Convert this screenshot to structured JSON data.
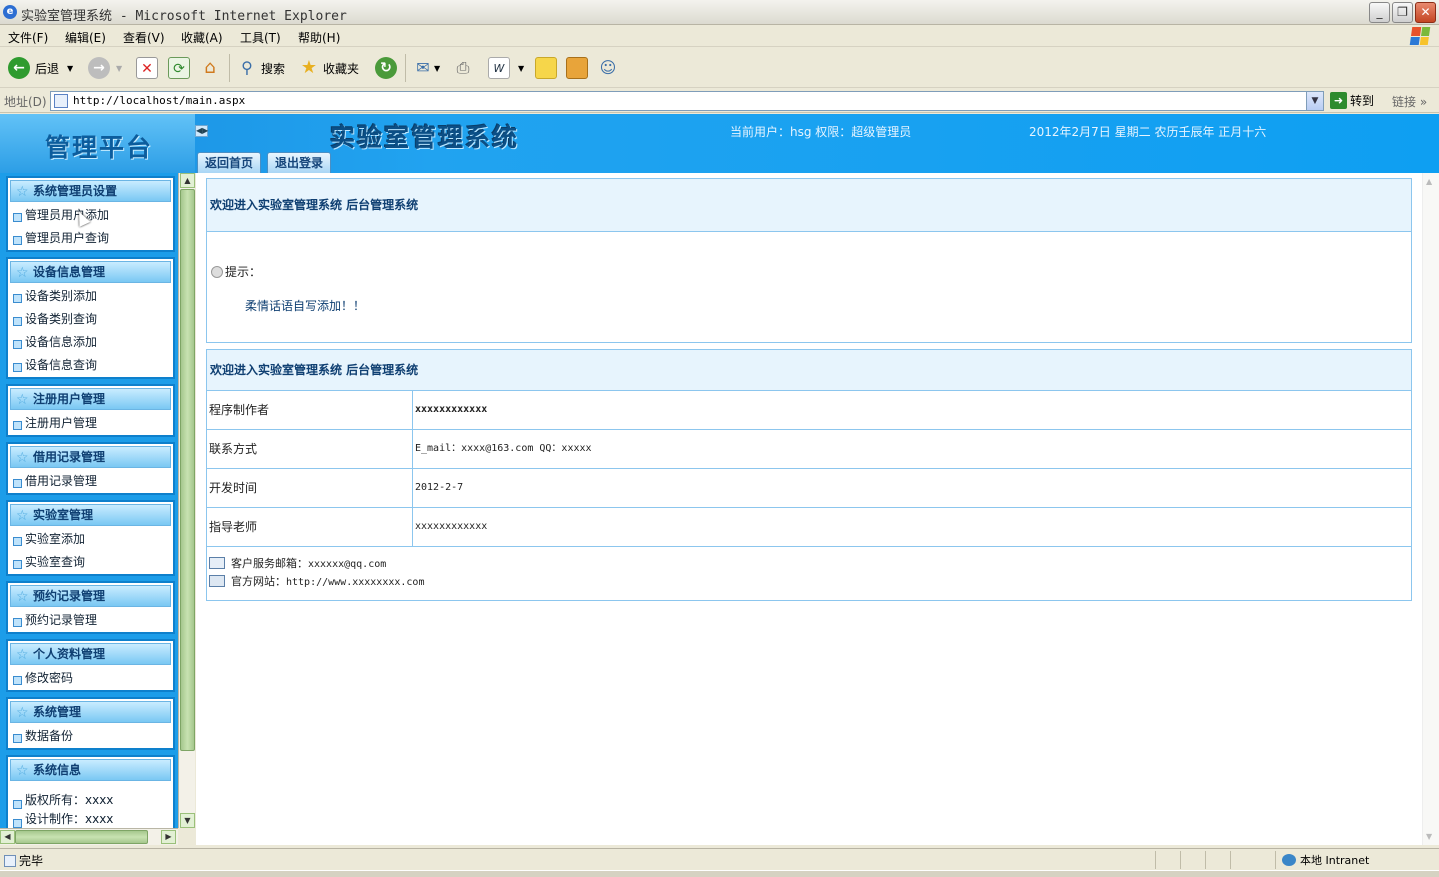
{
  "window": {
    "title": "实验室管理系统 - Microsoft Internet Explorer",
    "buttons": {
      "min": "_",
      "max": "❐",
      "close": "✕"
    }
  },
  "menu": [
    "文件(F)",
    "编辑(E)",
    "查看(V)",
    "收藏(A)",
    "工具(T)",
    "帮助(H)"
  ],
  "toolbar": {
    "back": "后退",
    "search": "搜索",
    "favorites": "收藏夹"
  },
  "address": {
    "label": "地址(D)",
    "url": "http://localhost/main.aspx",
    "go": "转到",
    "links": "链接"
  },
  "banner": {
    "logo": "管理平台",
    "system_title": "实验室管理系统",
    "current_user": "当前用户：hsg 权限：超级管理员",
    "date": "2012年2月7日 星期二 农历壬辰年 正月十六",
    "tabs": [
      "返回首页",
      "退出登录"
    ]
  },
  "sidebar": {
    "groups": [
      {
        "title": "系统管理员设置",
        "items": [
          "管理员用户添加",
          "管理员用户查询"
        ]
      },
      {
        "title": "设备信息管理",
        "items": [
          "设备类别添加",
          "设备类别查询",
          "设备信息添加",
          "设备信息查询"
        ]
      },
      {
        "title": "注册用户管理",
        "items": [
          "注册用户管理"
        ]
      },
      {
        "title": "借用记录管理",
        "items": [
          "借用记录管理"
        ]
      },
      {
        "title": "实验室管理",
        "items": [
          "实验室添加",
          "实验室查询"
        ]
      },
      {
        "title": "预约记录管理",
        "items": [
          "预约记录管理"
        ]
      },
      {
        "title": "个人资料管理",
        "items": [
          "修改密码"
        ]
      },
      {
        "title": "系统管理",
        "items": [
          "数据备份"
        ]
      },
      {
        "title": "系统信息",
        "items": [
          "版权所有：xxxx",
          "设计制作：xxxx"
        ]
      }
    ]
  },
  "main": {
    "panel1": {
      "title": "欢迎进入实验室管理系统 后台管理系统",
      "tip_label": "提示：",
      "tip_message": "柔情话语自写添加！！"
    },
    "panel2": {
      "title": "欢迎进入实验室管理系统 后台管理系统",
      "rows": [
        {
          "key": "程序制作者",
          "value": "xxxxxxxxxxxx"
        },
        {
          "key": "联系方式",
          "value": "E_mail：xxxx@163.com QQ：xxxxx"
        },
        {
          "key": "开发时间",
          "value": "2012-2-7"
        },
        {
          "key": "指导老师",
          "value": "xxxxxxxxxxxx"
        }
      ],
      "email_label": "客户服务邮箱：",
      "email": "xxxxxx@qq.com",
      "site_label": "官方网站：",
      "site": "http://www.xxxxxxxx.com"
    }
  },
  "status": {
    "text": "完毕",
    "zone": "本地 Intranet"
  }
}
